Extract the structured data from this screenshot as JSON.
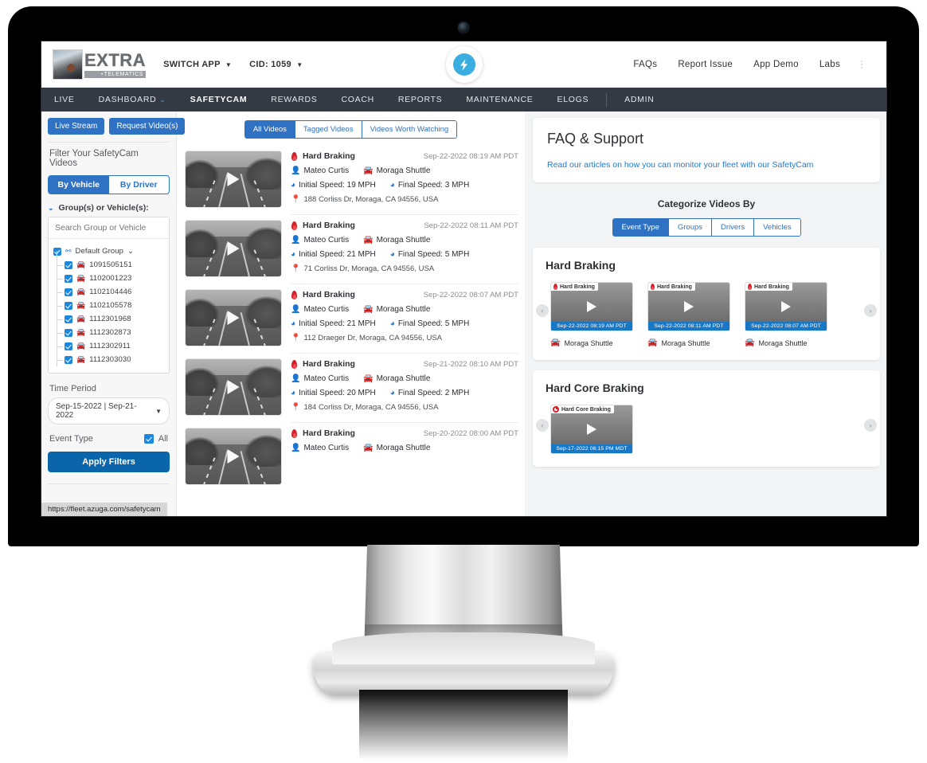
{
  "browser": {
    "status_url": "https://fleet.azuga.com/safetycam"
  },
  "header": {
    "logo_main": "EXTRA",
    "logo_sub": "+TELEMATICS",
    "switch_app": "SWITCH APP",
    "cid": "CID: 1059",
    "right_links": [
      "FAQs",
      "Report Issue",
      "App Demo",
      "Labs"
    ]
  },
  "nav": {
    "items": [
      {
        "label": "LIVE",
        "active": false,
        "caret": false
      },
      {
        "label": "DASHBOARD",
        "active": false,
        "caret": true
      },
      {
        "label": "SAFETYCAM",
        "active": true,
        "caret": false
      },
      {
        "label": "REWARDS",
        "active": false,
        "caret": false
      },
      {
        "label": "COACH",
        "active": false,
        "caret": false
      },
      {
        "label": "REPORTS",
        "active": false,
        "caret": false
      },
      {
        "label": "MAINTENANCE",
        "active": false,
        "caret": false
      },
      {
        "label": "ELOGS",
        "active": false,
        "caret": false
      },
      {
        "label": "ADMIN",
        "active": false,
        "caret": false
      }
    ]
  },
  "sidebar": {
    "live_stream": "Live Stream",
    "request_videos": "Request Video(s)",
    "filter_title": "Filter Your SafetyCam Videos",
    "by_vehicle": "By Vehicle",
    "by_driver": "By Driver",
    "group_label": "Group(s) or Vehicle(s):",
    "search_placeholder": "Search Group or Vehicle",
    "default_group": "Default Group",
    "vehicles": [
      "1091505151",
      "1102001223",
      "1102104446",
      "1102105578",
      "1112301968",
      "1112302873",
      "1112302911",
      "1112303030"
    ],
    "time_period_label": "Time Period",
    "time_period_value": "Sep-15-2022 | Sep-21-2022",
    "event_type_label": "Event Type",
    "event_type_all": "All",
    "apply_filters": "Apply Filters"
  },
  "center": {
    "tabs": [
      {
        "label": "All Videos",
        "active": true
      },
      {
        "label": "Tagged Videos",
        "active": false
      },
      {
        "label": "Videos Worth Watching",
        "active": false
      }
    ],
    "videos": [
      {
        "event": "Hard Braking",
        "timestamp": "Sep-22-2022 08:19 AM PDT",
        "driver": "Mateo Curtis",
        "vehicle": "Moraga Shuttle",
        "initial_speed": "Initial Speed: 19 MPH",
        "final_speed": "Final Speed: 3 MPH",
        "address": "188 Corliss Dr, Moraga, CA 94556, USA"
      },
      {
        "event": "Hard Braking",
        "timestamp": "Sep-22-2022 08:11 AM PDT",
        "driver": "Mateo Curtis",
        "vehicle": "Moraga Shuttle",
        "initial_speed": "Initial Speed: 21 MPH",
        "final_speed": "Final Speed: 5 MPH",
        "address": "71 Corliss Dr, Moraga, CA 94556, USA"
      },
      {
        "event": "Hard Braking",
        "timestamp": "Sep-22-2022 08:07 AM PDT",
        "driver": "Mateo Curtis",
        "vehicle": "Moraga Shuttle",
        "initial_speed": "Initial Speed: 21 MPH",
        "final_speed": "Final Speed: 5 MPH",
        "address": "112 Draeger Dr, Moraga, CA 94556, USA"
      },
      {
        "event": "Hard Braking",
        "timestamp": "Sep-21-2022 08:10 AM PDT",
        "driver": "Mateo Curtis",
        "vehicle": "Moraga Shuttle",
        "initial_speed": "Initial Speed: 20 MPH",
        "final_speed": "Final Speed: 2 MPH",
        "address": "184 Corliss Dr, Moraga, CA 94556, USA"
      },
      {
        "event": "Hard Braking",
        "timestamp": "Sep-20-2022 08:00 AM PDT",
        "driver": "Mateo Curtis",
        "vehicle": "Moraga Shuttle",
        "initial_speed": "",
        "final_speed": "",
        "address": ""
      }
    ]
  },
  "right": {
    "faq_title": "FAQ & Support",
    "faq_link": "Read our articles on how you can monitor your fleet with our SafetyCam",
    "categorize_title": "Categorize Videos By",
    "categorize_tabs": [
      {
        "label": "Event Type",
        "active": true
      },
      {
        "label": "Groups",
        "active": false
      },
      {
        "label": "Drivers",
        "active": false
      },
      {
        "label": "Vehicles",
        "active": false
      }
    ],
    "groups": [
      {
        "title": "Hard Braking",
        "icon": "flame",
        "cards": [
          {
            "badge": "Hard Braking",
            "time": "Sep-22-2022 08:19 AM PDT",
            "vehicle": "Moraga Shuttle"
          },
          {
            "badge": "Hard Braking",
            "time": "Sep-22-2022 08:11 AM PDT",
            "vehicle": "Moraga Shuttle"
          },
          {
            "badge": "Hard Braking",
            "time": "Sep-22-2022 08:07 AM PDT",
            "vehicle": "Moraga Shuttle"
          }
        ]
      },
      {
        "title": "Hard Core Braking",
        "icon": "ring",
        "cards": [
          {
            "badge": "Hard Core Braking",
            "time": "Sep-17-2022 06:15 PM MDT",
            "vehicle": ""
          }
        ]
      }
    ]
  },
  "colors": {
    "brand_blue": "#2f72c4",
    "accent_blue": "#1878c6",
    "nav_dark": "#343a44",
    "event_red": "#d62027"
  }
}
